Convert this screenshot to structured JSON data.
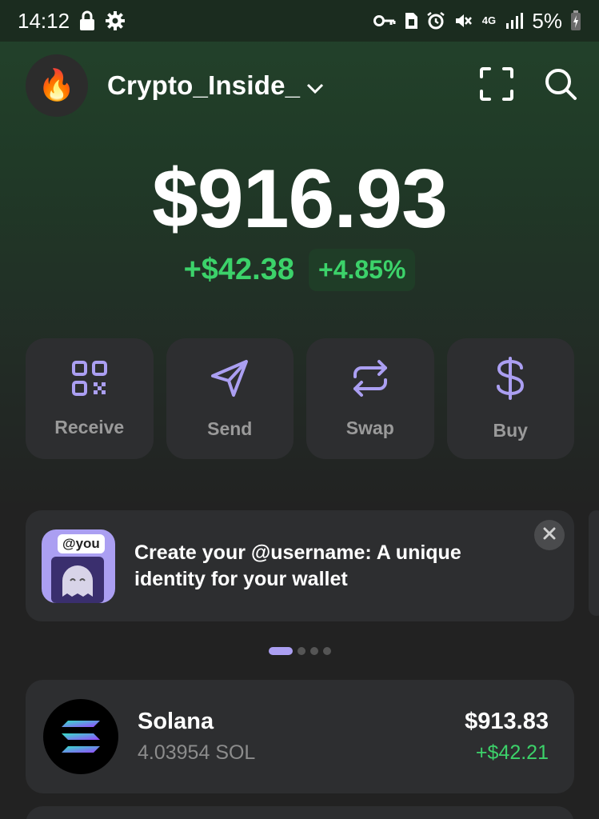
{
  "status_bar": {
    "time": "14:12",
    "network": "4G",
    "battery": "5%"
  },
  "header": {
    "account_name": "Crypto_Inside_",
    "avatar_emoji": "🔥"
  },
  "portfolio": {
    "balance": "$916.93",
    "change_amount": "+$42.38",
    "change_percent": "+4.85%"
  },
  "actions": [
    {
      "label": "Receive",
      "icon": "qr-code-icon"
    },
    {
      "label": "Send",
      "icon": "send-icon"
    },
    {
      "label": "Swap",
      "icon": "swap-icon"
    },
    {
      "label": "Buy",
      "icon": "dollar-icon"
    }
  ],
  "banner": {
    "tag": "@you",
    "text": "Create your @username: A unique identity for your wallet"
  },
  "carousel": {
    "pages": 4,
    "active": 1
  },
  "tokens": [
    {
      "name": "Solana",
      "amount": "4.03954 SOL",
      "value": "$913.83",
      "change": "+$42.21"
    }
  ],
  "colors": {
    "accent": "#ab9ff2",
    "positive": "#3cd26a",
    "card": "#2d2e30"
  }
}
